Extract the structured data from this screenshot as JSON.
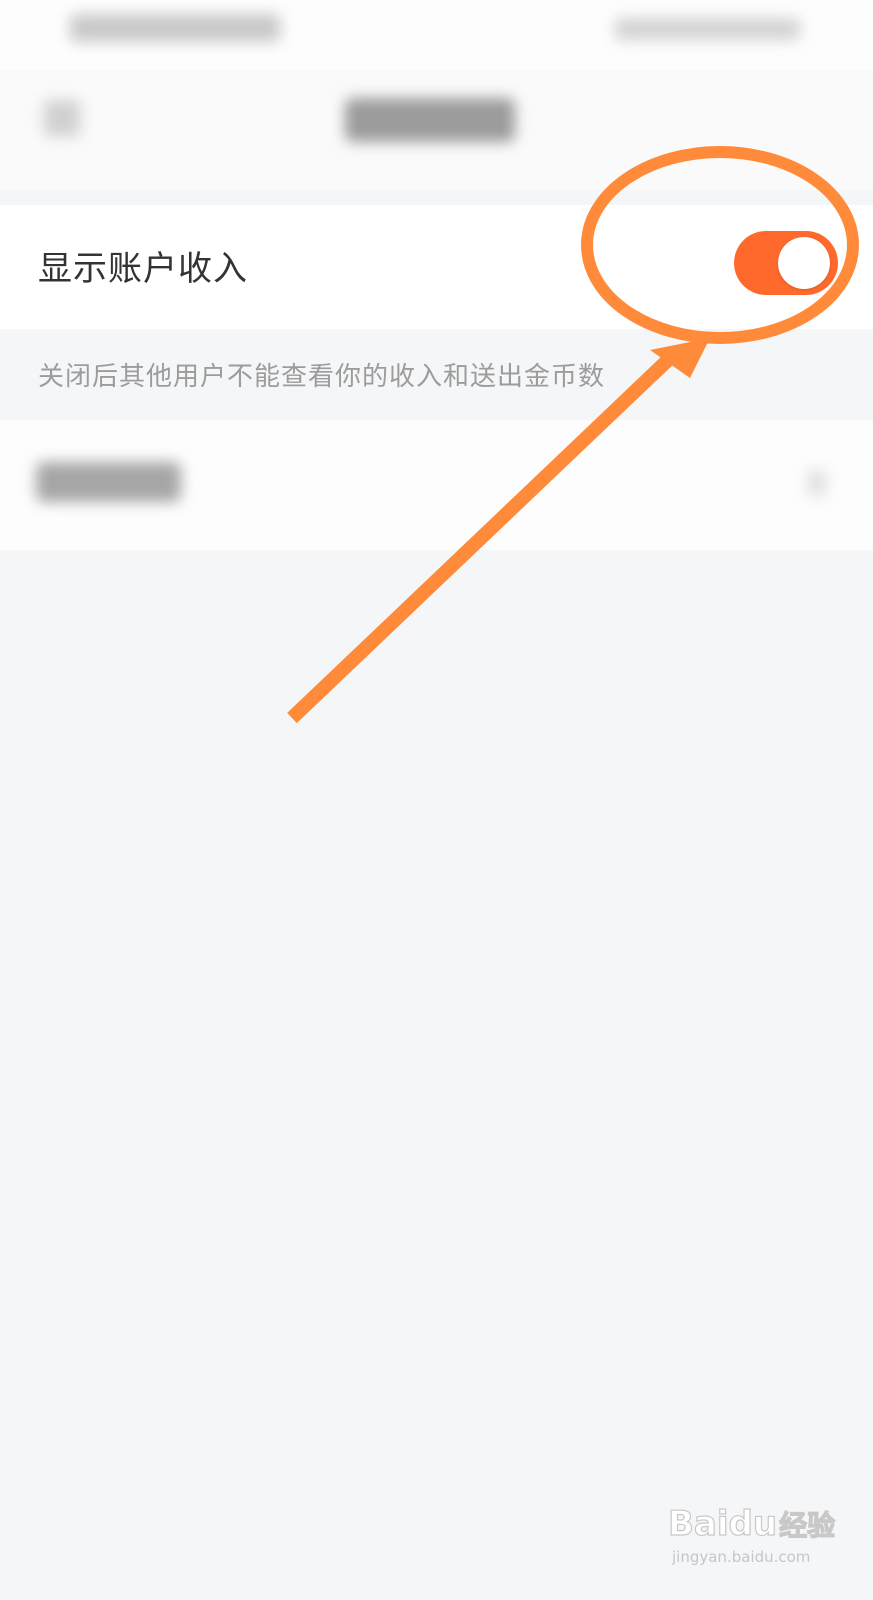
{
  "settings": {
    "show_income_label": "显示账户收入",
    "show_income_enabled": true,
    "show_income_description": "关闭后其他用户不能查看你的收入和送出金币数"
  },
  "colors": {
    "accent": "#ff6a2c",
    "annotation": "#ff8a3a",
    "page_background": "#f5f6f8"
  },
  "watermark": {
    "brand": "Baidu",
    "brand_cn": "经验",
    "url": "jingyan.baidu.com"
  }
}
